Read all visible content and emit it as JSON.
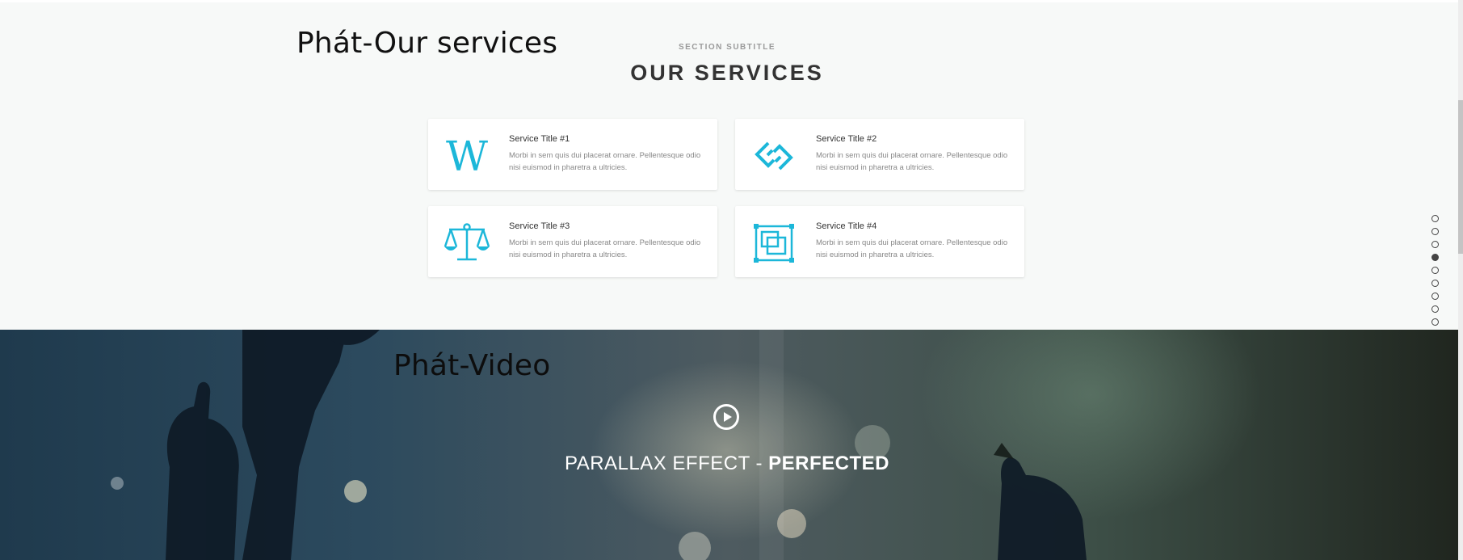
{
  "annotations": {
    "services_note": "Phát-Our services",
    "video_note": "Phát-Video"
  },
  "services": {
    "subtitle": "SECTION SUBTITLE",
    "title": "OUR SERVICES",
    "cards": [
      {
        "title": "Service Title #1",
        "description": "Morbi in sem quis dui placerat ornare. Pellentesque odio nisi euismod in pharetra a ultricies.",
        "icon": "wikipedia-w-icon"
      },
      {
        "title": "Service Title #2",
        "description": "Morbi in sem quis dui placerat ornare. Pellentesque odio nisi euismod in pharetra a ultricies.",
        "icon": "chain-link-icon"
      },
      {
        "title": "Service Title #3",
        "description": "Morbi in sem quis dui placerat ornare. Pellentesque odio nisi euismod in pharetra a ultricies.",
        "icon": "scales-icon"
      },
      {
        "title": "Service Title #4",
        "description": "Morbi in sem quis dui placerat ornare. Pellentesque odio nisi euismod in pharetra a ultricies.",
        "icon": "layers-frame-icon"
      }
    ],
    "accent_color": "#1cb7d9"
  },
  "section_nav": {
    "count": 9,
    "active_index": 3
  },
  "video": {
    "play_icon": "play-circle-icon",
    "headline_light": "PARALLAX EFFECT - ",
    "headline_bold": "PERFECTED"
  }
}
